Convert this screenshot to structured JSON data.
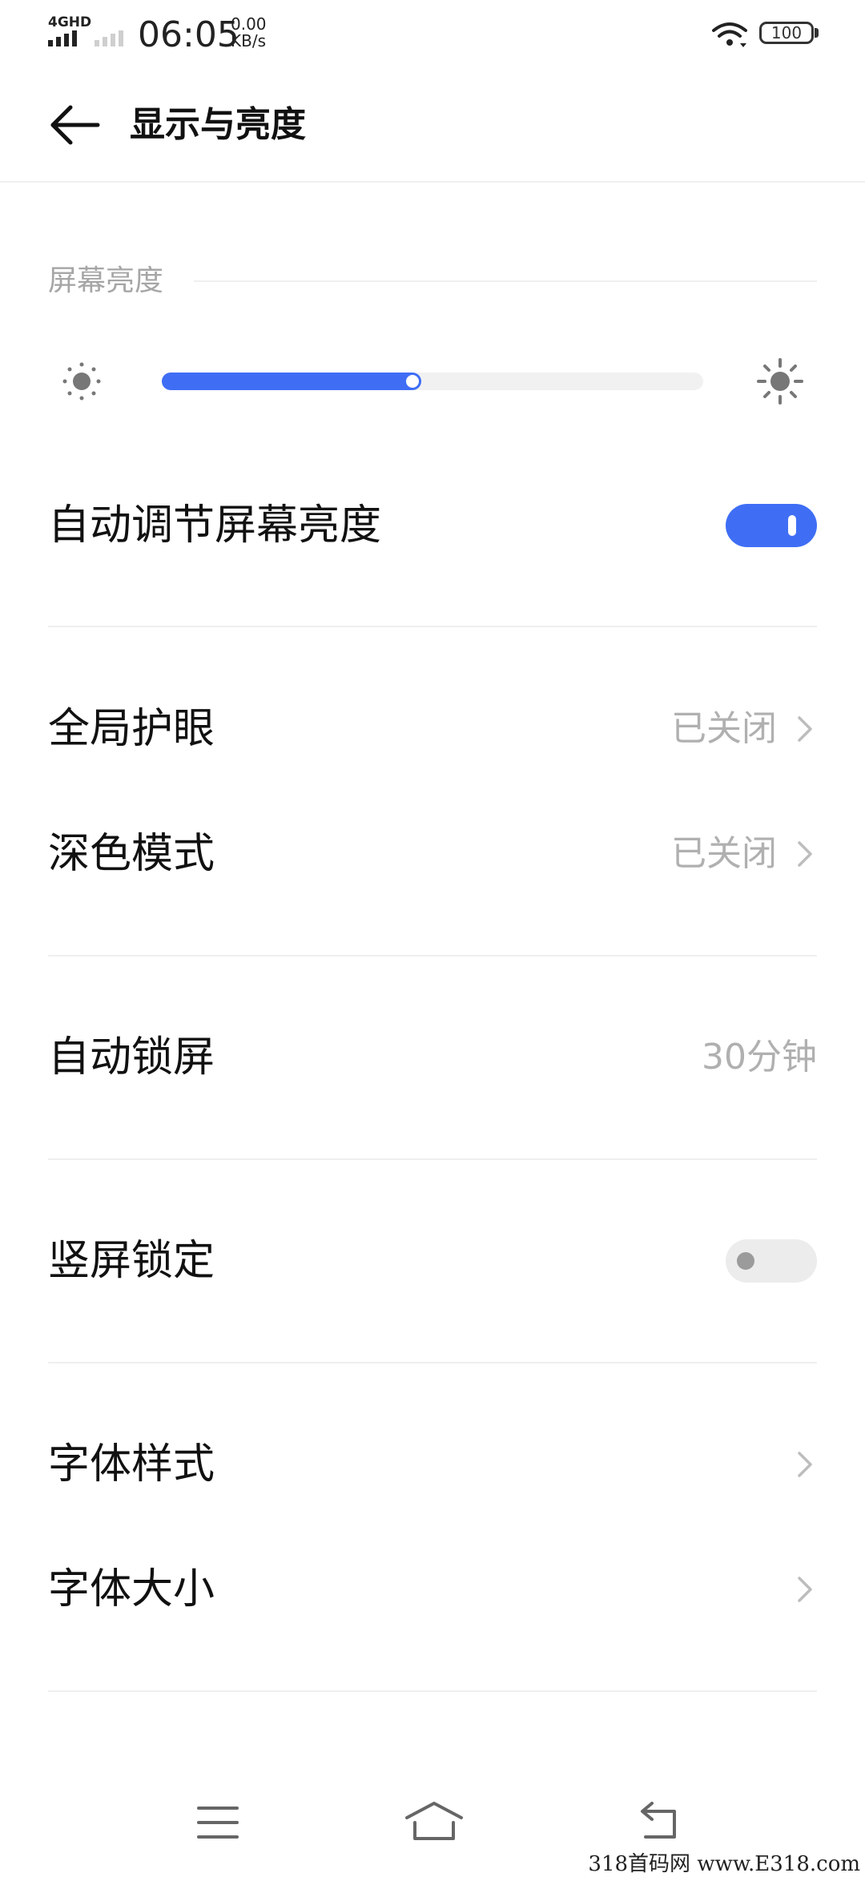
{
  "status_bar": {
    "network": "4GHD",
    "time": "06:05",
    "speed_value": "0.00",
    "speed_unit": "KB/s",
    "battery": "100"
  },
  "header": {
    "title": "显示与亮度"
  },
  "brightness": {
    "section_label": "屏幕亮度",
    "level_fraction": 0.48,
    "accent_color": "#3f6ef5"
  },
  "auto_brightness": {
    "label": "自动调节屏幕亮度",
    "enabled": true
  },
  "eye_care": {
    "label": "全局护眼",
    "value": "已关闭"
  },
  "dark_mode": {
    "label": "深色模式",
    "value": "已关闭"
  },
  "auto_lock": {
    "label": "自动锁屏",
    "value": "30分钟"
  },
  "portrait_lock": {
    "label": "竖屏锁定",
    "enabled": false
  },
  "font_style": {
    "label": "字体样式"
  },
  "font_size": {
    "label": "字体大小"
  },
  "nav": {
    "icons": [
      "menu-icon",
      "home-icon",
      "back-icon"
    ]
  },
  "watermark": "318首码网 www.E318.com"
}
